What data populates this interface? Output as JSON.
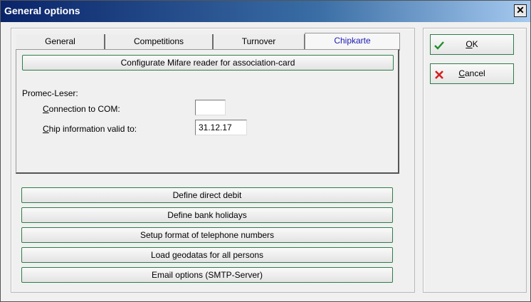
{
  "window": {
    "title": "General options",
    "close_glyph": "✕"
  },
  "tabs": [
    {
      "label": "General",
      "active": false
    },
    {
      "label": "Competitions",
      "active": false
    },
    {
      "label": "Turnover",
      "active": false
    },
    {
      "label": "Chipkarte",
      "active": true
    }
  ],
  "chip_tab": {
    "configure_button": "Configurate Mifare reader for association-card",
    "group_label": "Promec-Leser:",
    "com_label_first": "C",
    "com_label_rest": "onnection to COM:",
    "com_value": "",
    "chip_label_first": "C",
    "chip_label_rest": "hip information valid to:",
    "chip_value": "31.12.17"
  },
  "actions": [
    {
      "label": "Define direct debit"
    },
    {
      "label": "Define bank holidays"
    },
    {
      "label": "Setup format of telephone numbers"
    },
    {
      "label": "Load geodatas for all persons"
    },
    {
      "label": "Email options (SMTP-Server)"
    }
  ],
  "side": {
    "ok_first": "O",
    "ok_rest": "K",
    "cancel_first": "C",
    "cancel_rest": "ancel"
  },
  "colors": {
    "ok_icon": "#1e8f2a",
    "cancel_icon": "#d42020",
    "active_tab_text": "#1a1ab4",
    "button_border": "#2e7c4a"
  }
}
